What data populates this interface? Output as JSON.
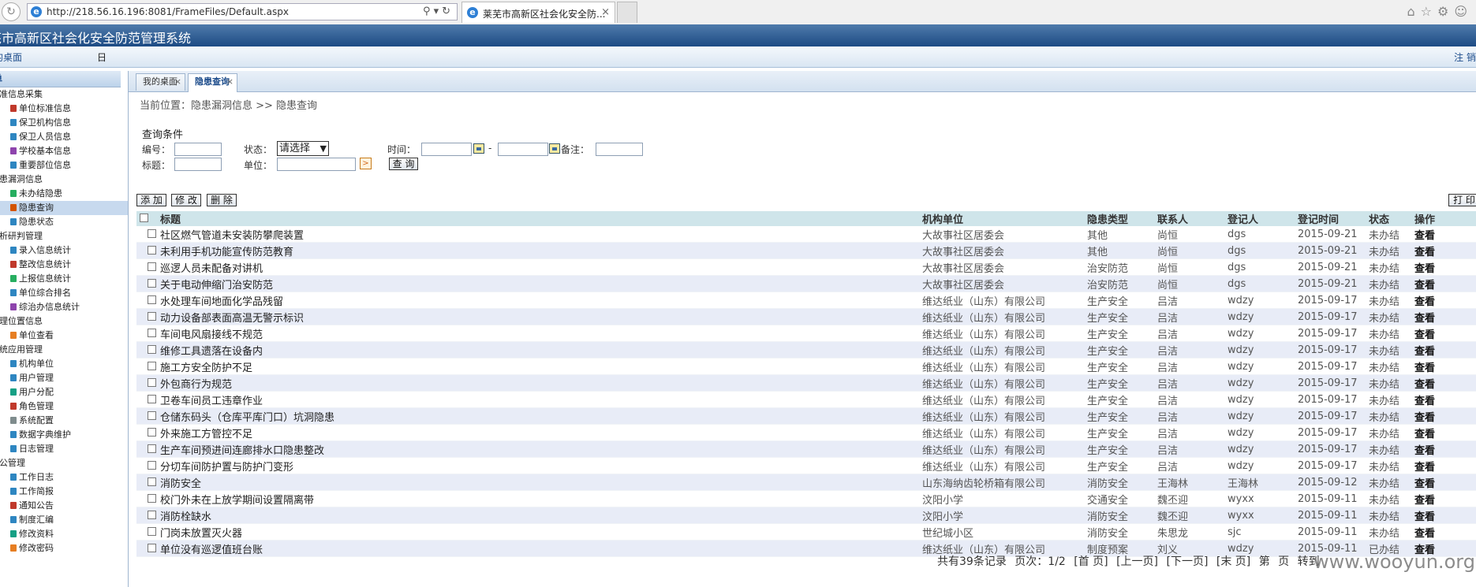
{
  "browser": {
    "url": "http://218.56.16.196:8081/FrameFiles/Default.aspx",
    "tab_title": "莱芜市高新区社会化安全防...",
    "tab_close": "×"
  },
  "app": {
    "title": "芜市高新区社会化安全防范管理系统",
    "desk_link": "的桌面",
    "day_text": "日",
    "logout": "注 销"
  },
  "sidebar": {
    "header": "单",
    "items": [
      {
        "label": "标准信息采集",
        "type": "group"
      },
      {
        "label": "单位标准信息",
        "type": "item",
        "color": "#c0392b"
      },
      {
        "label": "保卫机构信息",
        "type": "item",
        "color": "#2e86c1"
      },
      {
        "label": "保卫人员信息",
        "type": "item",
        "color": "#2e86c1"
      },
      {
        "label": "学校基本信息",
        "type": "item",
        "color": "#8e44ad"
      },
      {
        "label": "重要部位信息",
        "type": "item",
        "color": "#2e86c1"
      },
      {
        "label": "隐患漏洞信息",
        "type": "group"
      },
      {
        "label": "未办结隐患",
        "type": "item",
        "color": "#27ae60"
      },
      {
        "label": "隐患查询",
        "type": "item",
        "color": "#d35400",
        "active": true
      },
      {
        "label": "隐患状态",
        "type": "item",
        "color": "#2e86c1"
      },
      {
        "label": "分析研判管理",
        "type": "group"
      },
      {
        "label": "录入信息统计",
        "type": "item",
        "color": "#2e86c1"
      },
      {
        "label": "整改信息统计",
        "type": "item",
        "color": "#c0392b"
      },
      {
        "label": "上报信息统计",
        "type": "item",
        "color": "#27ae60"
      },
      {
        "label": "单位综合排名",
        "type": "item",
        "color": "#2e86c1"
      },
      {
        "label": "综治办信息统计",
        "type": "item",
        "color": "#8e44ad"
      },
      {
        "label": "地理位置信息",
        "type": "group"
      },
      {
        "label": "单位查看",
        "type": "item",
        "color": "#e67e22"
      },
      {
        "label": "系统应用管理",
        "type": "group"
      },
      {
        "label": "机构单位",
        "type": "item",
        "color": "#2e86c1"
      },
      {
        "label": "用户管理",
        "type": "item",
        "color": "#2e86c1"
      },
      {
        "label": "用户分配",
        "type": "item",
        "color": "#16a085"
      },
      {
        "label": "角色管理",
        "type": "item",
        "color": "#c0392b"
      },
      {
        "label": "系统配置",
        "type": "item",
        "color": "#7f8c8d"
      },
      {
        "label": "数据字典维护",
        "type": "item",
        "color": "#2e86c1"
      },
      {
        "label": "日志管理",
        "type": "item",
        "color": "#2e86c1"
      },
      {
        "label": "办公管理",
        "type": "group"
      },
      {
        "label": "工作日志",
        "type": "item",
        "color": "#2e86c1"
      },
      {
        "label": "工作简报",
        "type": "item",
        "color": "#2e86c1"
      },
      {
        "label": "通知公告",
        "type": "item",
        "color": "#c0392b"
      },
      {
        "label": "制度汇编",
        "type": "item",
        "color": "#2e86c1"
      },
      {
        "label": "修改资料",
        "type": "item",
        "color": "#16a085"
      },
      {
        "label": "修改密码",
        "type": "item",
        "color": "#e67e22"
      }
    ]
  },
  "main": {
    "tabs": [
      {
        "label": "我的桌面",
        "close": "×"
      },
      {
        "label": "隐患查询",
        "close": "×"
      }
    ],
    "breadcrumb": "当前位置：隐患漏洞信息 >> 隐患查询",
    "query": {
      "title": "查询条件",
      "id_label": "编号：",
      "status_label": "状态：",
      "status_value": "请选择",
      "time_label": "时间：",
      "dash": "-",
      "remark_label": "备注：",
      "title_label": "标题：",
      "unit_label": "单位：",
      "unit_pick": ">",
      "search_btn": "查 询"
    },
    "toolbar": {
      "add": "添 加",
      "edit": "修 改",
      "delete": "删 除",
      "print": "打 印"
    },
    "table": {
      "headers": [
        "标题",
        "机构单位",
        "隐患类型",
        "联系人",
        "登记人",
        "登记时间",
        "状态",
        "操作"
      ],
      "rows": [
        [
          "社区燃气管道未安装防攀爬装置",
          "大故事社区居委会",
          "其他",
          "尚恒",
          "dgs",
          "2015-09-21",
          "未办结",
          "查看"
        ],
        [
          "未利用手机功能宣传防范教育",
          "大故事社区居委会",
          "其他",
          "尚恒",
          "dgs",
          "2015-09-21",
          "未办结",
          "查看"
        ],
        [
          "巡逻人员未配备对讲机",
          "大故事社区居委会",
          "治安防范",
          "尚恒",
          "dgs",
          "2015-09-21",
          "未办结",
          "查看"
        ],
        [
          "关于电动伸缩门治安防范",
          "大故事社区居委会",
          "治安防范",
          "尚恒",
          "dgs",
          "2015-09-21",
          "未办结",
          "查看"
        ],
        [
          "水处理车间地面化学品残留",
          "维达纸业（山东）有限公司",
          "生产安全",
          "吕洁",
          "wdzy",
          "2015-09-17",
          "未办结",
          "查看"
        ],
        [
          "动力设备部表面高温无警示标识",
          "维达纸业（山东）有限公司",
          "生产安全",
          "吕洁",
          "wdzy",
          "2015-09-17",
          "未办结",
          "查看"
        ],
        [
          "车间电风扇接线不规范",
          "维达纸业（山东）有限公司",
          "生产安全",
          "吕洁",
          "wdzy",
          "2015-09-17",
          "未办结",
          "查看"
        ],
        [
          "维修工具遗落在设备内",
          "维达纸业（山东）有限公司",
          "生产安全",
          "吕洁",
          "wdzy",
          "2015-09-17",
          "未办结",
          "查看"
        ],
        [
          "施工方安全防护不足",
          "维达纸业（山东）有限公司",
          "生产安全",
          "吕洁",
          "wdzy",
          "2015-09-17",
          "未办结",
          "查看"
        ],
        [
          "外包商行为规范",
          "维达纸业（山东）有限公司",
          "生产安全",
          "吕洁",
          "wdzy",
          "2015-09-17",
          "未办结",
          "查看"
        ],
        [
          "卫卷车间员工违章作业",
          "维达纸业（山东）有限公司",
          "生产安全",
          "吕洁",
          "wdzy",
          "2015-09-17",
          "未办结",
          "查看"
        ],
        [
          "仓储东码头（仓库平库门口）坑洞隐患",
          "维达纸业（山东）有限公司",
          "生产安全",
          "吕洁",
          "wdzy",
          "2015-09-17",
          "未办结",
          "查看"
        ],
        [
          "外来施工方管控不足",
          "维达纸业（山东）有限公司",
          "生产安全",
          "吕洁",
          "wdzy",
          "2015-09-17",
          "未办结",
          "查看"
        ],
        [
          "生产车间预进间连廊排水口隐患整改",
          "维达纸业（山东）有限公司",
          "生产安全",
          "吕洁",
          "wdzy",
          "2015-09-17",
          "未办结",
          "查看"
        ],
        [
          "分切车间防护置与防护门变形",
          "维达纸业（山东）有限公司",
          "生产安全",
          "吕洁",
          "wdzy",
          "2015-09-17",
          "未办结",
          "查看"
        ],
        [
          "消防安全",
          "山东海纳齿轮桥箱有限公司",
          "消防安全",
          "王海林",
          "王海林",
          "2015-09-12",
          "未办结",
          "查看"
        ],
        [
          "校门外未在上放学期间设置隔离带",
          "汶阳小学",
          "交通安全",
          "魏丕迎",
          "wyxx",
          "2015-09-11",
          "未办结",
          "查看"
        ],
        [
          "消防栓缺水",
          "汶阳小学",
          "消防安全",
          "魏丕迎",
          "wyxx",
          "2015-09-11",
          "未办结",
          "查看"
        ],
        [
          "门岗未放置灭火器",
          "世纪城小区",
          "消防安全",
          "朱思龙",
          "sjc",
          "2015-09-11",
          "未办结",
          "查看"
        ],
        [
          "单位没有巡逻值班台账",
          "维达纸业（山东）有限公司",
          "制度预案",
          "刘义",
          "wdzy",
          "2015-09-11",
          "已办结",
          "查看"
        ]
      ]
    },
    "pager": {
      "total": "共有39条记录",
      "page_label": "页次：1/2",
      "first": "[首 页]",
      "prev": "[上一页]",
      "next": "[下一页]",
      "last": "[末 页]",
      "goto_label": "第",
      "goto_suffix": "页",
      "go": "转到"
    },
    "watermark": "www.wooyun.org"
  }
}
